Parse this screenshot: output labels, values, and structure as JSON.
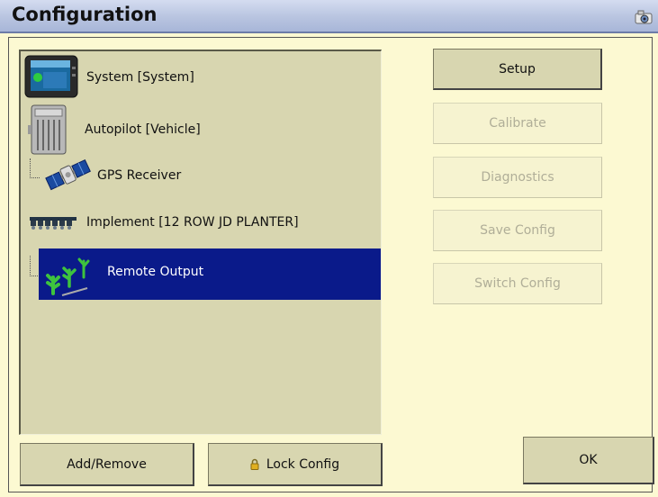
{
  "window": {
    "title": "Configuration",
    "camera_icon": "camera-icon"
  },
  "tree": {
    "items": [
      {
        "label": "System [System]",
        "icon": "display-icon"
      },
      {
        "label": "Autopilot [Vehicle]",
        "icon": "controller-box-icon"
      },
      {
        "label": "GPS Receiver",
        "icon": "satellite-icon"
      },
      {
        "label": "Implement [12 ROW JD PLANTER]",
        "icon": "planter-icon"
      },
      {
        "label": "Remote Output",
        "icon": "crop-plants-icon",
        "selected": true
      }
    ]
  },
  "side_buttons": {
    "setup": "Setup",
    "calibrate": "Calibrate",
    "diagnostics": "Diagnostics",
    "save_config": "Save Config",
    "switch_config": "Switch Config"
  },
  "bottom_buttons": {
    "add_remove": "Add/Remove",
    "lock_config": "Lock Config",
    "ok": "OK"
  },
  "colors": {
    "background": "#fcf9d2",
    "panel": "#d8d6b0",
    "selection": "#0a1a8a",
    "titlebar": "#b8c4e0"
  }
}
